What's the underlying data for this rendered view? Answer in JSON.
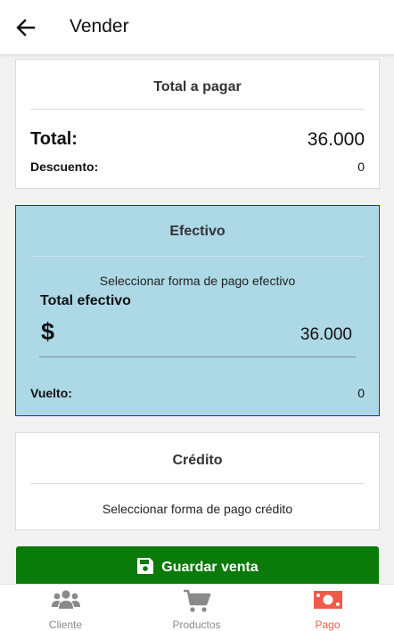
{
  "header": {
    "title": "Vender"
  },
  "total_card": {
    "heading": "Total a pagar",
    "total_label": "Total:",
    "total_value": "36.000",
    "discount_label": "Descuento:",
    "discount_value": "0"
  },
  "cash_card": {
    "heading": "Efectivo",
    "hint": "Seleccionar forma de pago efectivo",
    "field_label": "Total efectivo",
    "currency_symbol": "$",
    "field_value": "36.000",
    "change_label": "Vuelto:",
    "change_value": "0",
    "colors": {
      "background": "#add8e6",
      "border": "#2525c8"
    }
  },
  "credit_card": {
    "heading": "Crédito",
    "hint": "Seleccionar forma de pago crédito"
  },
  "save_button": {
    "label": "Guardar venta",
    "icon": "floppy-disk-icon",
    "color": "#0a7a0a"
  },
  "bottom_nav": {
    "items": [
      {
        "label": "Cliente",
        "icon": "users-icon",
        "active": false
      },
      {
        "label": "Productos",
        "icon": "shopping-cart-icon",
        "active": false
      },
      {
        "label": "Pago",
        "icon": "money-bill-icon",
        "active": true
      }
    ],
    "active_color": "#ef5a4a",
    "inactive_color": "#8a8a8a"
  }
}
